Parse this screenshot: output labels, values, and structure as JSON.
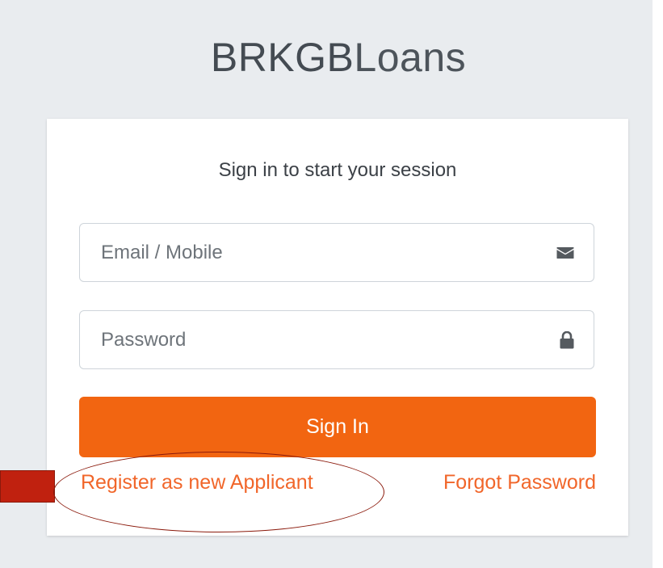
{
  "app": {
    "logo_bold": "BRKGB",
    "logo_light": "Loans"
  },
  "login": {
    "title": "Sign in to start your session",
    "email": {
      "placeholder": "Email / Mobile",
      "value": "",
      "icon": "envelope-icon"
    },
    "password": {
      "placeholder": "Password",
      "value": "",
      "icon": "lock-icon"
    },
    "signin_label": "Sign In",
    "register_label": "Register as new Applicant",
    "forgot_label": "Forgot Password"
  },
  "colors": {
    "page_background": "#e9ecef",
    "card_background": "#ffffff",
    "accent": "#f26511",
    "link": "#f1662a",
    "annotation": "#c0210f"
  }
}
